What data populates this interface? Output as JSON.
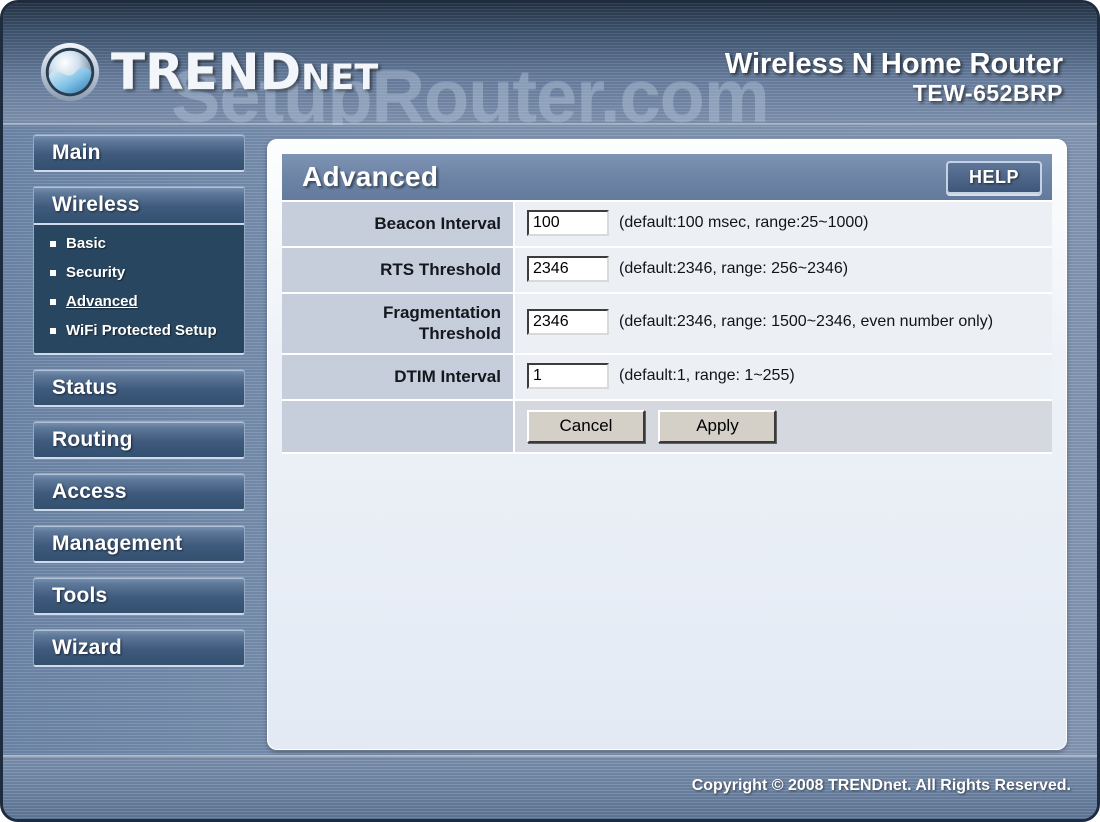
{
  "header": {
    "brand_upper": "TREND",
    "brand_lower": "net",
    "product_name": "Wireless N Home Router",
    "product_model": "TEW-652BRP",
    "watermark": "SetupRouter.com"
  },
  "sidebar": {
    "items": [
      {
        "label": "Main",
        "type": "button"
      },
      {
        "label": "Wireless",
        "type": "group",
        "children": [
          {
            "label": "Basic",
            "active": false
          },
          {
            "label": "Security",
            "active": false
          },
          {
            "label": "Advanced",
            "active": true
          },
          {
            "label": "WiFi Protected Setup",
            "active": false
          }
        ]
      },
      {
        "label": "Status",
        "type": "button"
      },
      {
        "label": "Routing",
        "type": "button"
      },
      {
        "label": "Access",
        "type": "button"
      },
      {
        "label": "Management",
        "type": "button"
      },
      {
        "label": "Tools",
        "type": "button"
      },
      {
        "label": "Wizard",
        "type": "button"
      }
    ]
  },
  "panel": {
    "title": "Advanced",
    "help_label": "HELP",
    "rows": [
      {
        "label": "Beacon Interval",
        "value": "100",
        "hint": "(default:100 msec, range:25~1000)"
      },
      {
        "label": "RTS Threshold",
        "value": "2346",
        "hint": "(default:2346, range: 256~2346)"
      },
      {
        "label": "Fragmentation Threshold",
        "label_line1": "Fragmentation",
        "label_line2": "Threshold",
        "value": "2346",
        "hint": "(default:2346, range: 1500~2346, even number only)"
      },
      {
        "label": "DTIM Interval",
        "value": "1",
        "hint": "(default:1, range: 1~255)"
      }
    ],
    "actions": {
      "cancel_label": "Cancel",
      "apply_label": "Apply"
    }
  },
  "footer": {
    "copyright": "Copyright © 2008 TRENDnet. All Rights Reserved."
  },
  "colors": {
    "frame_border": "#1d2c3e",
    "page_bg": "#7f94b2",
    "nav_button": "#3f5a7d",
    "submenu_bg": "#28465f",
    "panel_title_bar": "#6d84a6",
    "label_cell": "#c6cedc",
    "field_cell": "#eceff3",
    "accent_white": "#ffffff"
  }
}
